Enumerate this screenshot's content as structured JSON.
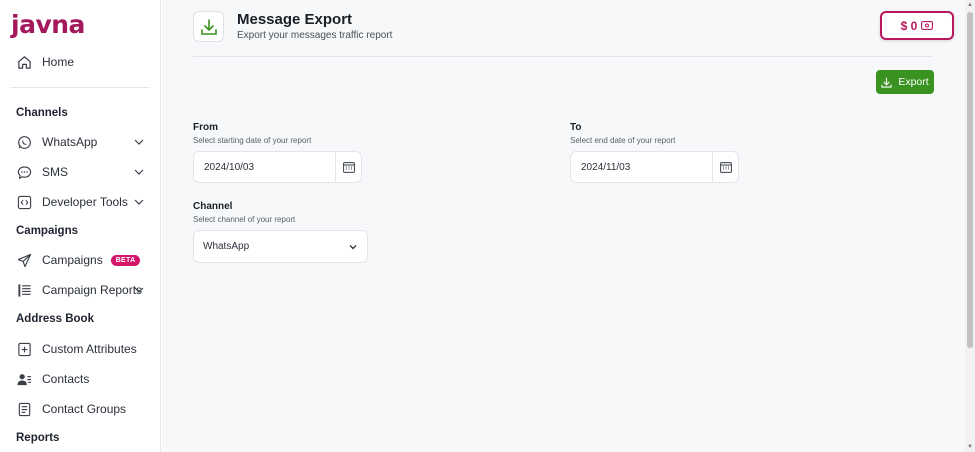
{
  "brand": {
    "logo_text": "javna",
    "accent": "#a3195b"
  },
  "sidebar": {
    "home": "Home",
    "sections": {
      "channels": "Channels",
      "campaigns": "Campaigns",
      "address_book": "Address Book",
      "reports": "Reports"
    },
    "items": {
      "whatsapp": "WhatsApp",
      "sms": "SMS",
      "developer_tools": "Developer Tools",
      "campaigns": "Campaigns",
      "campaigns_badge": "BETA",
      "campaign_reports": "Campaign Reports",
      "custom_attributes": "Custom Attributes",
      "contacts": "Contacts",
      "contact_groups": "Contact Groups"
    }
  },
  "header": {
    "title": "Message Export",
    "subtitle": "Export your messages traffic report",
    "balance": "$ 0"
  },
  "actions": {
    "export_label": "Export",
    "export_color": "#3a9321"
  },
  "form": {
    "from": {
      "label": "From",
      "hint": "Select starting date of your report",
      "value": "2024/10/03"
    },
    "to": {
      "label": "To",
      "hint": "Select end date of your report",
      "value": "2024/11/03"
    },
    "channel": {
      "label": "Channel",
      "hint": "Select channel of your report",
      "value": "WhatsApp"
    }
  }
}
